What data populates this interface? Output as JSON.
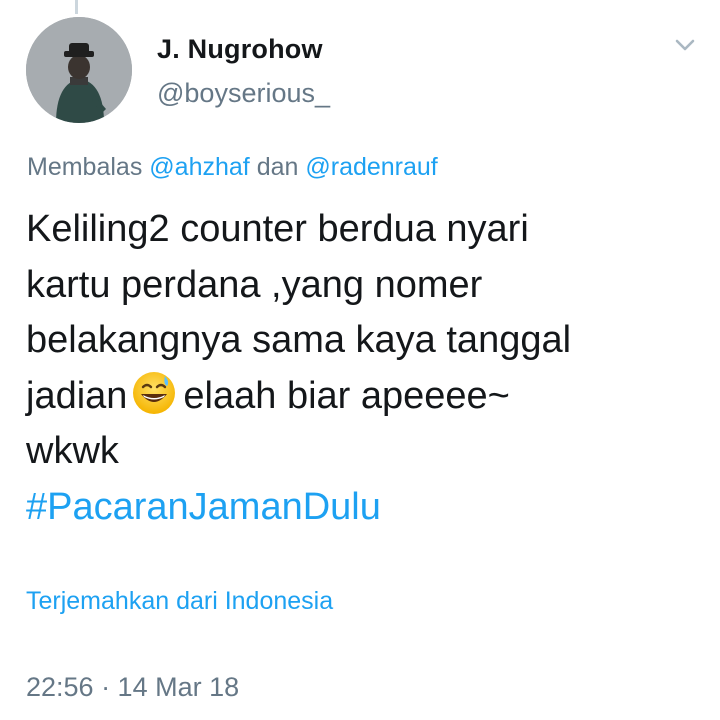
{
  "tweet": {
    "author": {
      "display_name": "J. Nugrohow",
      "handle": "@boyserious_",
      "avatar_icon": "profile-photo"
    },
    "reply_context": {
      "prefix": "Membalas",
      "mention_1": "@ahzhaf",
      "joiner": "dan",
      "mention_2": "@radenrauf"
    },
    "text": {
      "line_1": "Keliling2 counter berdua nyari",
      "line_2": "kartu perdana ,yang nomer",
      "line_3": "belakangnya sama kaya tanggal",
      "line_4_before_emoji": "jadian",
      "emoji": "grinning-sweat-face-emoji",
      "line_4_after_emoji": "elaah biar apeeee~",
      "line_5": "wkwk",
      "hashtag": "#PacaranJamanDulu"
    },
    "translate_label": "Terjemahkan dari Indonesia",
    "timestamp": "22:56 · 14 Mar 18",
    "menu_icon": "chevron-down-icon"
  },
  "colors": {
    "link": "#1da1f2",
    "secondary_text": "#657786",
    "primary_text": "#14171a",
    "thread_line": "#ccd6dd"
  }
}
